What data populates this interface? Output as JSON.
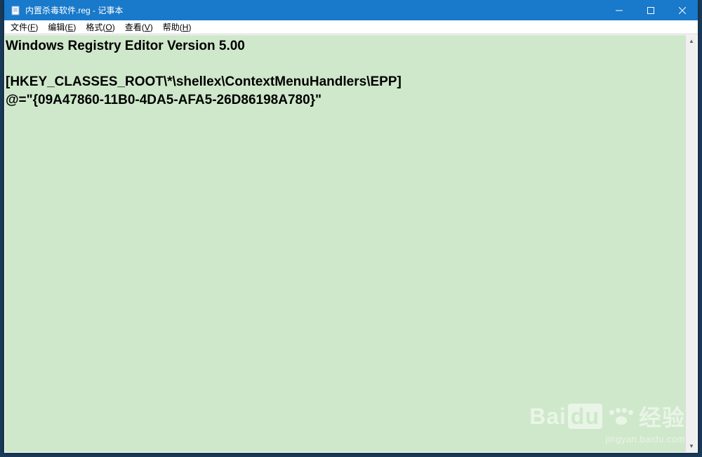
{
  "titlebar": {
    "title": "内置杀毒软件.reg - 记事本"
  },
  "menu": {
    "file": {
      "label": "文件",
      "access": "F"
    },
    "edit": {
      "label": "编辑",
      "access": "E"
    },
    "format": {
      "label": "格式",
      "access": "O"
    },
    "view": {
      "label": "查看",
      "access": "V"
    },
    "help": {
      "label": "帮助",
      "access": "H"
    }
  },
  "content": {
    "line1": "Windows Registry Editor Version 5.00",
    "line2": "",
    "line3": "[HKEY_CLASSES_ROOT\\*\\shellex\\ContextMenuHandlers\\EPP]",
    "line4": "@=\"{09A47860-11B0-4DA5-AFA5-26D86198A780}\""
  },
  "watermark": {
    "logo_left": "Bai",
    "logo_right": "经验",
    "url": "jingyan.baidu.com"
  }
}
